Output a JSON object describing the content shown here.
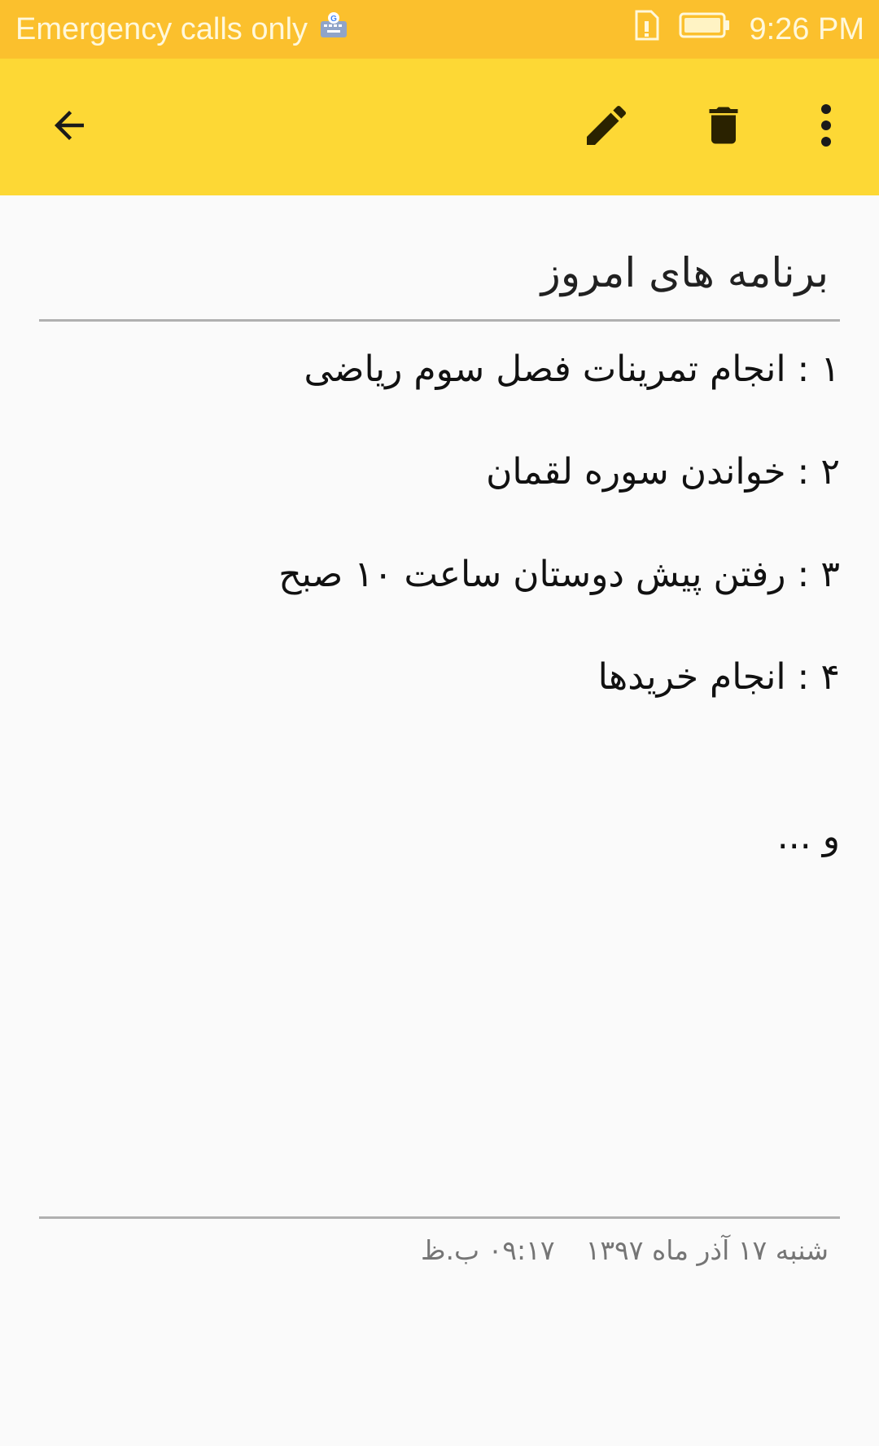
{
  "status_bar": {
    "carrier_text": "Emergency calls only",
    "time": "9:26 PM",
    "icons": [
      "keyboard-icon",
      "sim-alert-icon",
      "battery-icon"
    ]
  },
  "toolbar": {
    "icons": [
      "back-arrow-icon",
      "edit-pencil-icon",
      "delete-trash-icon",
      "more-vert-icon"
    ]
  },
  "note": {
    "title": "برنامه های امروز",
    "lines": [
      "۱ : انجام تمرینات فصل سوم ریاضی",
      "۲ : خواندن سوره لقمان",
      "۳ : رفتن پیش دوستان ساعت ۱۰ صبح",
      "۴  : انجام خریدها",
      "و ..."
    ]
  },
  "footer": {
    "date": "شنبه ۱۷ آذر ماه ۱۳۹۷",
    "time": "۰۹:۱۷ ب.ظ"
  },
  "colors": {
    "status_bar": "#fbc02d",
    "toolbar": "#fdd835",
    "background": "#fafafa",
    "divider": "#b0b0b0"
  }
}
